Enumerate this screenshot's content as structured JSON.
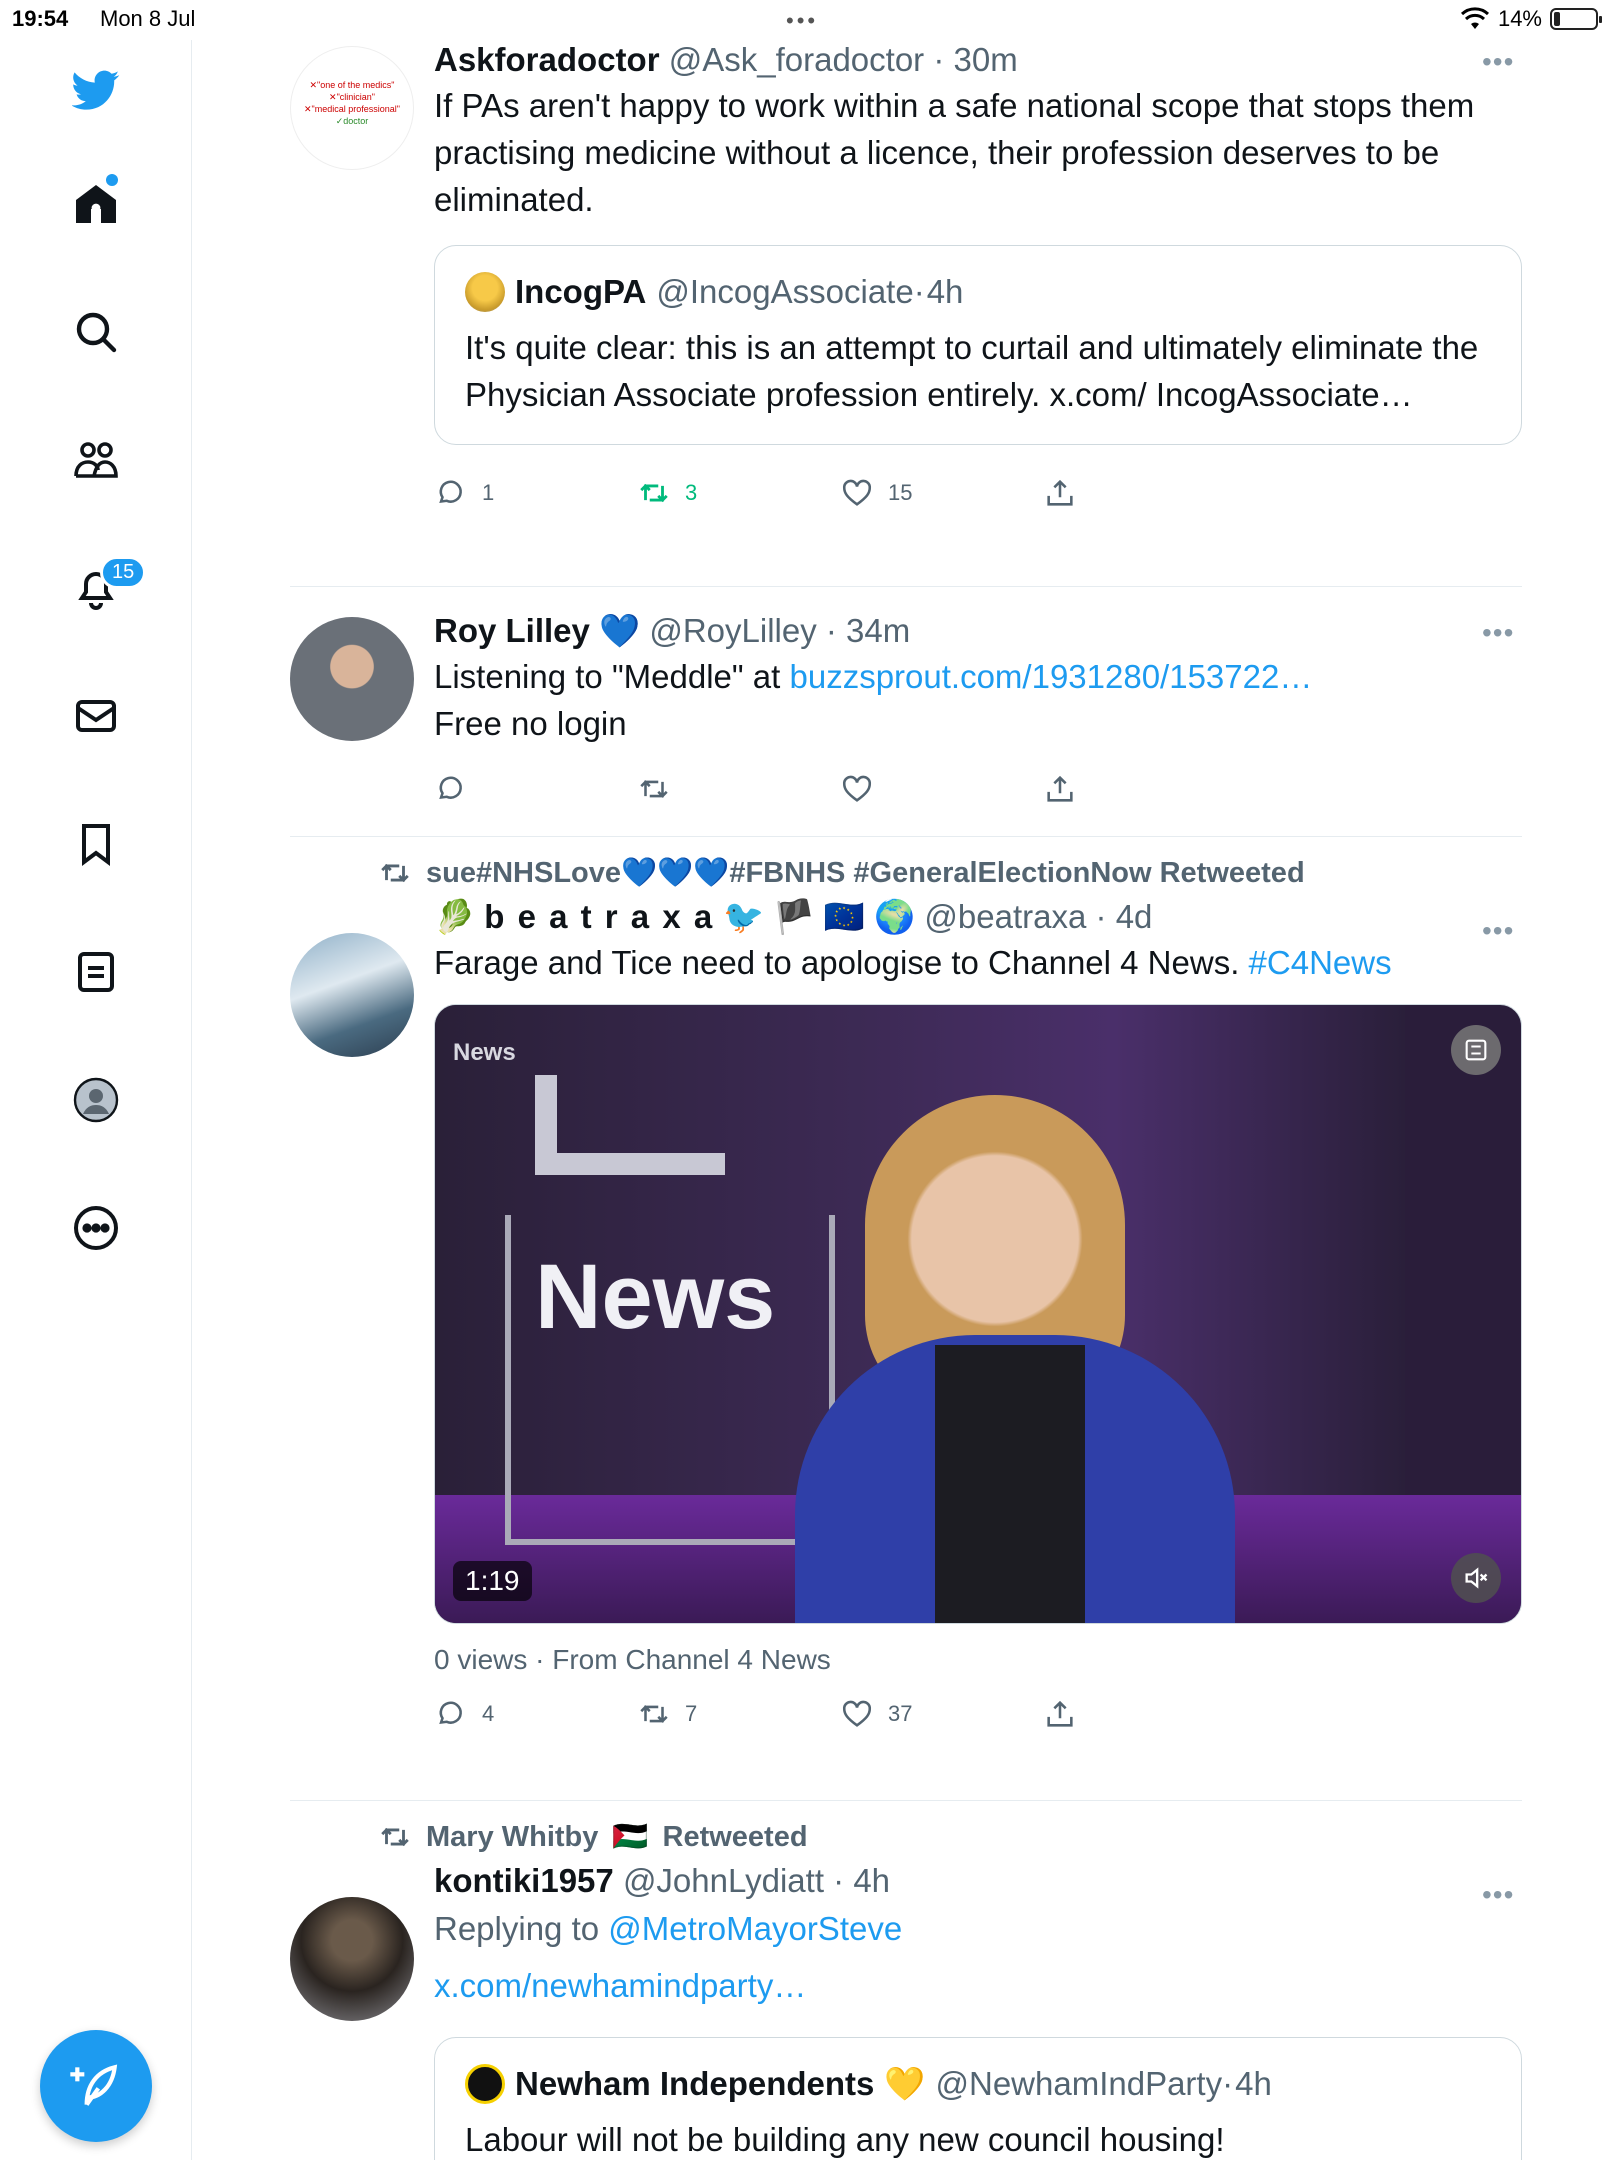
{
  "status_bar": {
    "time": "19:54",
    "date": "Mon 8 Jul",
    "battery": "14%"
  },
  "sidebar": {
    "notifications_badge": "15",
    "items": [
      "twitter-logo",
      "home-icon",
      "search-icon",
      "communities-icon",
      "notifications-icon",
      "messages-icon",
      "bookmarks-icon",
      "lists-icon",
      "profile-icon",
      "more-icon"
    ],
    "compose_label": "compose"
  },
  "tweets": [
    {
      "name": "Askforadoctor",
      "handle": "@Ask_foradoctor",
      "time": "30m",
      "text": "If PAs aren't happy to work within a safe national scope that stops them practising medicine without a licence, their profession deserves to be eliminated.",
      "avatar_lines": [
        "\"one of the medics\"",
        "\"clinician\"",
        "\"medical professional\"",
        "doctor"
      ],
      "quote": {
        "name": "IncogPA",
        "handle": "@IncogAssociate",
        "time": "4h",
        "text": "It's quite clear: this is an attempt to curtail and ultimately eliminate the Physician Associate profession entirely. x.com/ IncogAssociate…"
      },
      "replies": "1",
      "retweets": "3",
      "likes": "15"
    },
    {
      "name": "Roy Lilley",
      "name_emoji": "💙",
      "handle": "@RoyLilley",
      "time": "34m",
      "text_prefix": "Listening to \"Meddle\" at ",
      "link": "buzzsprout.com/1931280/153722…",
      "text_line2": "Free no login"
    },
    {
      "retweeted_by": "sue#NHSLove💙💙💙#FBNHS #GeneralElectionNow Retweeted",
      "name": "b e a t r a x a",
      "handle": "@beatraxa",
      "time": "4d",
      "text_prefix": "Farage and Tice need to apologise to Channel 4 News. ",
      "hashtag": "#C4News",
      "video_duration": "1:19",
      "video_label_small": "News",
      "video_label_big": "News",
      "views_text": "0 views · From Channel 4 News",
      "replies": "4",
      "retweets": "7",
      "likes": "37"
    },
    {
      "retweeted_by_name": "Mary Whitby",
      "retweeted_suffix": "Retweeted",
      "name": "kontiki1957",
      "handle": "@JohnLydiatt",
      "time": "4h",
      "replying_prefix": "Replying to ",
      "replying_to": "@MetroMayorSteve",
      "link": "x.com/newhamindparty…",
      "quote": {
        "name": "Newham Independents",
        "name_emoji": "💛",
        "handle": "@NewhamIndParty",
        "time": "4h",
        "text": "Labour will not be building any new council housing!"
      }
    }
  ],
  "colors": {
    "accent": "#1d9bf0",
    "retweet_green": "#00ba7c",
    "muted": "#536471"
  }
}
